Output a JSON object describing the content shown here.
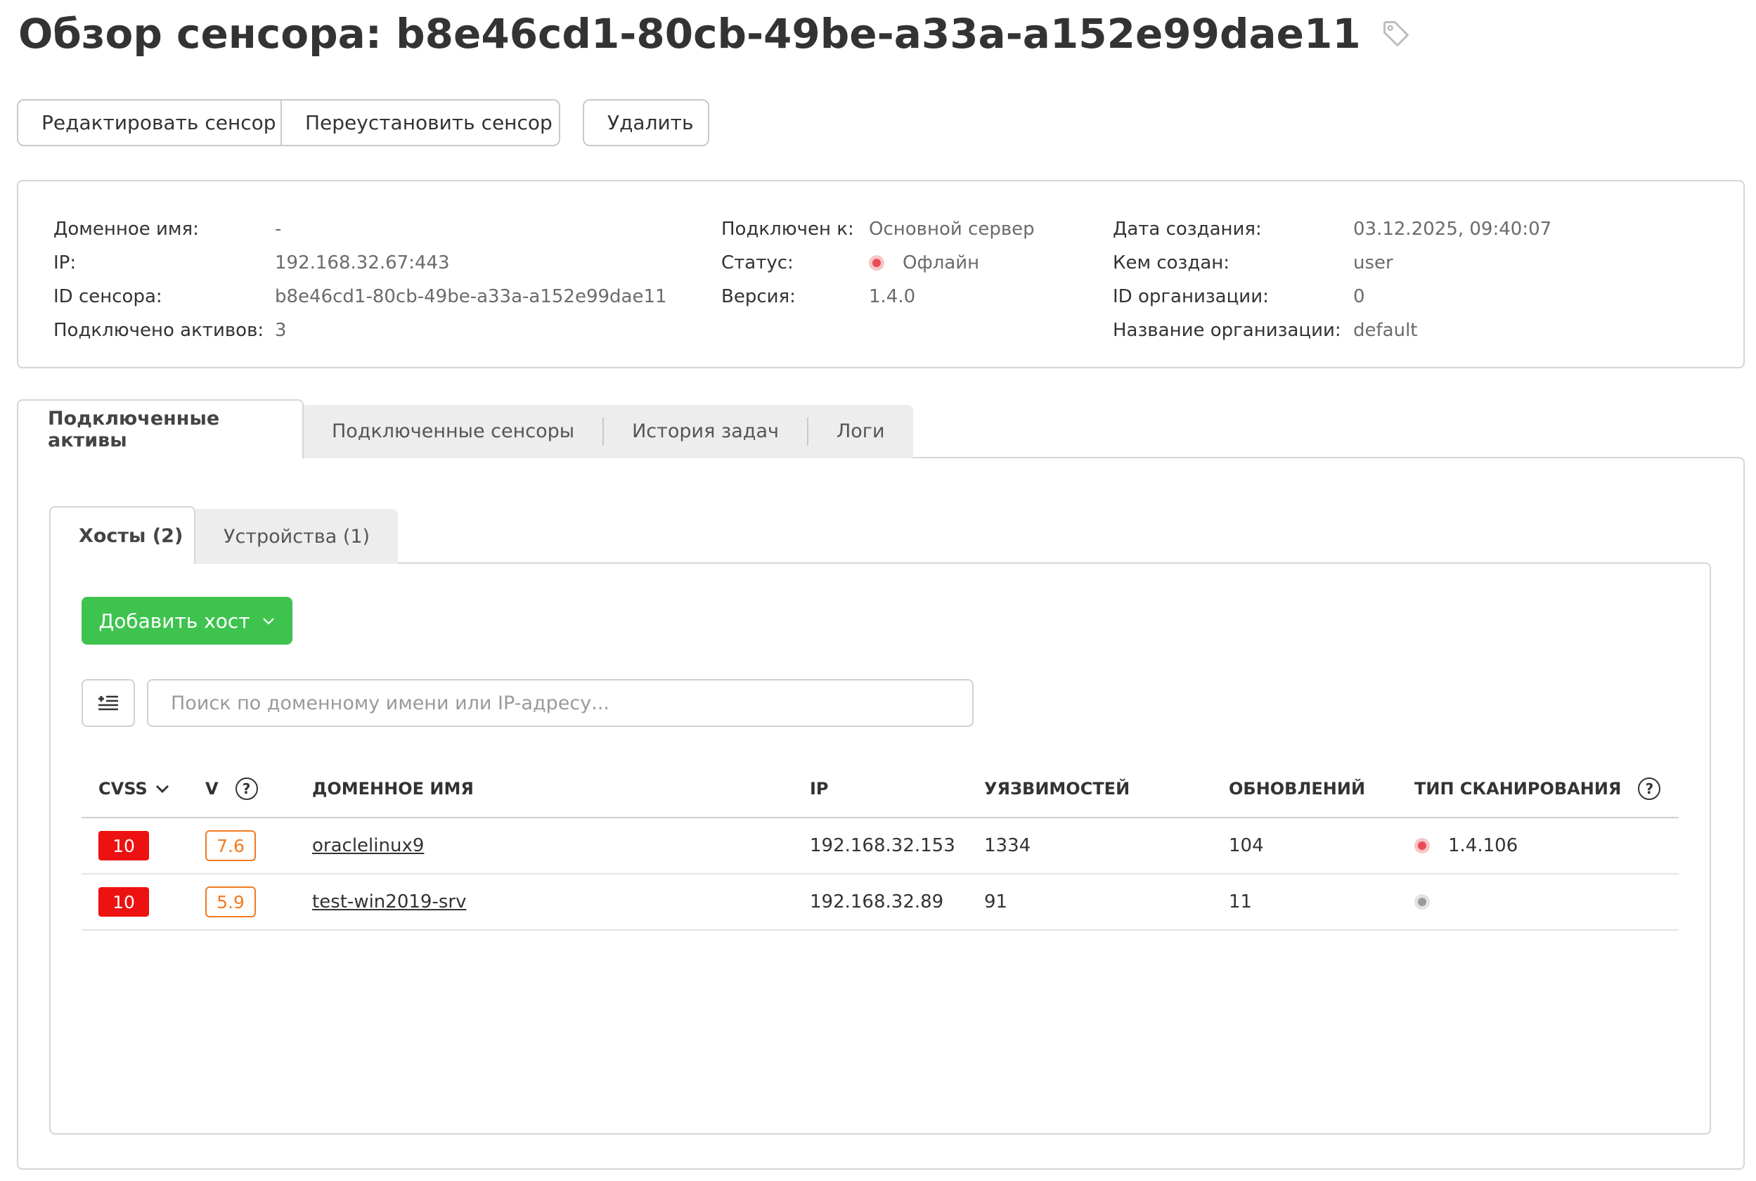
{
  "page": {
    "title": "Обзор сенсора: b8e46cd1-80cb-49be-a33a-a152e99dae11",
    "title_icon": "tag-icon"
  },
  "actions": {
    "edit_label": "Редактировать сенсор",
    "reinstall_label": "Переустановить сенсор",
    "delete_label": "Удалить"
  },
  "info": {
    "col1": [
      {
        "label": "Доменное имя:",
        "value": "-"
      },
      {
        "label": "IP:",
        "value": "192.168.32.67:443"
      },
      {
        "label": "ID сенсора:",
        "value": "b8e46cd1-80cb-49be-a33a-a152e99dae11"
      },
      {
        "label": "Подключено активов:",
        "value": "3"
      }
    ],
    "col2": [
      {
        "label": "Подключен к:",
        "value": "Основной сервер"
      },
      {
        "label": "Статус:",
        "value": "Офлайн",
        "status_color": "#ec4b55"
      },
      {
        "label": "Версия:",
        "value": "1.4.0"
      }
    ],
    "col3": [
      {
        "label": "Дата создания:",
        "value": "03.12.2025, 09:40:07"
      },
      {
        "label": "Кем создан:",
        "value": "user"
      },
      {
        "label": "ID организации:",
        "value": "0"
      },
      {
        "label": "Название организации:",
        "value": "default"
      }
    ]
  },
  "main_tabs": [
    {
      "label": "Подключенные активы",
      "active": true
    },
    {
      "label": "Подключенные сенсоры",
      "active": false
    },
    {
      "label": "История задач",
      "active": false
    },
    {
      "label": "Логи",
      "active": false
    }
  ],
  "sub_tabs": [
    {
      "label": "Хосты (2)",
      "active": true
    },
    {
      "label": "Устройства (1)",
      "active": false
    }
  ],
  "toolbar": {
    "add_host_label": "Добавить хост",
    "search_placeholder": "Поиск по доменному имени или IP-адресу..."
  },
  "table": {
    "headers": {
      "cvss": "CVSS",
      "v": "V",
      "domain": "ДОМЕННОЕ ИМЯ",
      "ip": "IP",
      "vulns": "УЯЗВИМОСТЕЙ",
      "updates": "ОБНОВЛЕНИЙ",
      "scan_type": "ТИП СКАНИРОВАНИЯ"
    },
    "rows": [
      {
        "cvss": "10",
        "v": "7.6",
        "domain": "oraclelinux9",
        "ip": "192.168.32.153",
        "vulns": "1334",
        "updates": "104",
        "scan_status": "red",
        "scan_version": "1.4.106"
      },
      {
        "cvss": "10",
        "v": "5.9",
        "domain": "test-win2019-srv",
        "ip": "192.168.32.89",
        "vulns": "91",
        "updates": "11",
        "scan_status": "grey",
        "scan_version": ""
      }
    ]
  },
  "colors": {
    "accent_green": "#3ec34f",
    "cvss_red": "#ee1111",
    "v_orange": "#f07b22",
    "offline_red": "#ec4b55"
  }
}
